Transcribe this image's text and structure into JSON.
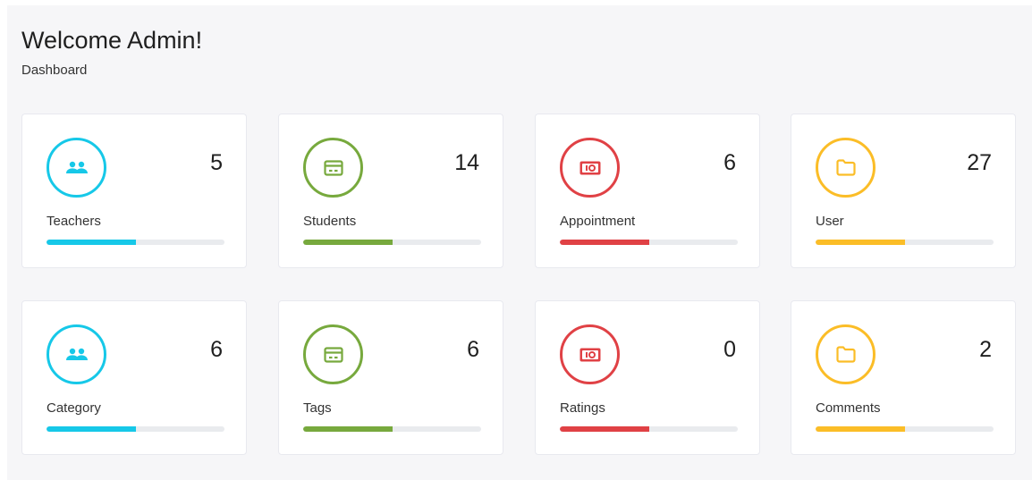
{
  "header": {
    "title": "Welcome Admin!",
    "breadcrumb": "Dashboard"
  },
  "colors": {
    "cyan": "#16c8e8",
    "green": "#77a93d",
    "red": "#e04145",
    "yellow": "#fbbd27"
  },
  "cards": [
    {
      "label": "Teachers",
      "count": "5",
      "icon": "people-icon",
      "color": "cyan",
      "progress_percent": 50
    },
    {
      "label": "Students",
      "count": "14",
      "icon": "card-icon",
      "color": "green",
      "progress_percent": 50
    },
    {
      "label": "Appointment",
      "count": "6",
      "icon": "money-icon",
      "color": "red",
      "progress_percent": 50
    },
    {
      "label": "User",
      "count": "27",
      "icon": "folder-icon",
      "color": "yellow",
      "progress_percent": 50
    },
    {
      "label": "Category",
      "count": "6",
      "icon": "people-icon",
      "color": "cyan",
      "progress_percent": 50
    },
    {
      "label": "Tags",
      "count": "6",
      "icon": "card-icon",
      "color": "green",
      "progress_percent": 50
    },
    {
      "label": "Ratings",
      "count": "0",
      "icon": "money-icon",
      "color": "red",
      "progress_percent": 50
    },
    {
      "label": "Comments",
      "count": "2",
      "icon": "folder-icon",
      "color": "yellow",
      "progress_percent": 50
    }
  ]
}
